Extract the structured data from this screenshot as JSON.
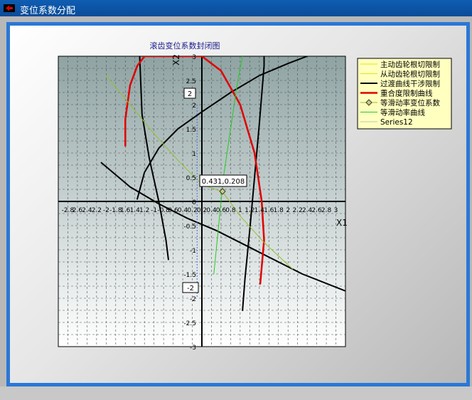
{
  "window": {
    "title": "变位系数分配"
  },
  "colors": {
    "titlebar": "#0a4c98",
    "frame": "#2a78d6"
  },
  "chart_data": {
    "type": "line",
    "title": "滚齿变位系数封闭图",
    "xlabel": "X1",
    "ylabel": "X2",
    "xlim": [
      -3,
      3
    ],
    "ylim": [
      -3,
      3
    ],
    "grid": true,
    "legend_position": "top-right",
    "x_tick_labels": [
      "-2.8",
      "2.6",
      "2.4",
      "2.2",
      "-2",
      "-1.8",
      "1.6",
      "1.4",
      "1.2",
      "-1",
      "-0.8",
      "0.6",
      "0.4",
      "0.2",
      "0.2",
      "0.4",
      "0.6",
      "0.8",
      "1",
      "1.2",
      "1.4",
      "1.6",
      "1.8",
      "2",
      "2.2",
      "2.4",
      "2.6",
      "2.8",
      "3"
    ],
    "y_ticks": [
      3,
      2.5,
      2,
      1.5,
      1,
      0.5,
      0,
      -0.5,
      -1,
      -1.5,
      -2,
      -2.5,
      -3
    ],
    "y_tick_labels": [
      "3",
      "2.5",
      "2",
      "1.5",
      "1",
      "0.5",
      "0",
      "-0.5",
      "-1",
      "-1.5",
      "-2",
      "-2.5",
      "-3"
    ],
    "crosshair": {
      "x": 0.431,
      "y": 0.208,
      "label": "0.431,0.208",
      "y_top_label": "2",
      "y_bottom_label": "-2"
    },
    "series": [
      {
        "name": "主动齿轮根切限制",
        "color": "#e6e600",
        "width": 1,
        "points": []
      },
      {
        "name": "从动齿轮根切限制",
        "color": "#e6e600",
        "width": 1,
        "points": []
      },
      {
        "name": "过渡曲线干涉限制",
        "color": "#000000",
        "width": 2,
        "points": []
      },
      {
        "name": "重合度限制曲线",
        "color": "#e00000",
        "width": 2.5,
        "points": []
      },
      {
        "name": "等滑动率变位系数",
        "color": "#90c030",
        "width": 1,
        "marker": "diamond",
        "points": []
      },
      {
        "name": "等滑动率曲线",
        "color": "#22cc22",
        "width": 1,
        "points": []
      },
      {
        "name": "Series12",
        "color": "#c0c0c0",
        "width": 1,
        "points": []
      }
    ],
    "curves": [
      {
        "series": 2,
        "color": "#000000",
        "width": 2,
        "points": [
          [
            -1.3,
            3
          ],
          [
            -1.25,
            1.8
          ],
          [
            -1.1,
            0.9
          ],
          [
            -0.9,
            0
          ],
          [
            -0.75,
            -0.8
          ],
          [
            -0.7,
            -1.2
          ]
        ]
      },
      {
        "series": 2,
        "color": "#000000",
        "width": 2,
        "points": [
          [
            -1.35,
            0.05
          ],
          [
            -1.2,
            0.6
          ],
          [
            -0.9,
            1.1
          ],
          [
            -0.5,
            1.5
          ],
          [
            0,
            1.85
          ],
          [
            0.6,
            2.25
          ],
          [
            1.2,
            2.6
          ],
          [
            1.8,
            2.85
          ],
          [
            2.2,
            3
          ]
        ]
      },
      {
        "series": 2,
        "color": "#000000",
        "width": 2,
        "points": [
          [
            -2.1,
            0.8
          ],
          [
            -1.5,
            0.3
          ],
          [
            -0.9,
            -0.05
          ],
          [
            -0.3,
            -0.35
          ],
          [
            0.3,
            -0.6
          ],
          [
            0.9,
            -0.9
          ],
          [
            1.5,
            -1.2
          ],
          [
            2.1,
            -1.5
          ],
          [
            3,
            -1.85
          ]
        ]
      },
      {
        "series": 2,
        "color": "#000000",
        "width": 2,
        "points": [
          [
            0.85,
            -2.25
          ],
          [
            0.9,
            -1.6
          ],
          [
            1,
            -0.6
          ],
          [
            1.1,
            0.5
          ],
          [
            1.2,
            1.6
          ],
          [
            1.3,
            2.8
          ],
          [
            1.3,
            3
          ]
        ]
      },
      {
        "series": 3,
        "color": "#e00000",
        "width": 2.5,
        "points": [
          [
            -1.6,
            1.15
          ],
          [
            -1.6,
            1.7
          ],
          [
            -1.5,
            2.4
          ],
          [
            -1.35,
            2.8
          ],
          [
            -1.2,
            3
          ],
          [
            0,
            3
          ],
          [
            0.4,
            2.7
          ],
          [
            0.8,
            2
          ],
          [
            1.1,
            1
          ],
          [
            1.25,
            0
          ],
          [
            1.3,
            -0.8
          ],
          [
            1.22,
            -1.7
          ]
        ]
      },
      {
        "series": 4,
        "color": "#90c030",
        "width": 1,
        "points": [
          [
            -2,
            2.6
          ],
          [
            -1.5,
            2
          ],
          [
            -1,
            1.4
          ],
          [
            -0.5,
            0.85
          ],
          [
            0,
            0.35
          ],
          [
            0.43,
            0.2
          ],
          [
            0.8,
            -0.3
          ],
          [
            1.3,
            -0.85
          ],
          [
            1.9,
            -1.4
          ]
        ]
      },
      {
        "series": 5,
        "color": "#22cc22",
        "width": 1,
        "points": [
          [
            0.25,
            -1.5
          ],
          [
            0.35,
            -0.5
          ],
          [
            0.45,
            0.5
          ],
          [
            0.6,
            1.5
          ],
          [
            0.75,
            2.5
          ],
          [
            0.85,
            3
          ]
        ]
      }
    ]
  }
}
